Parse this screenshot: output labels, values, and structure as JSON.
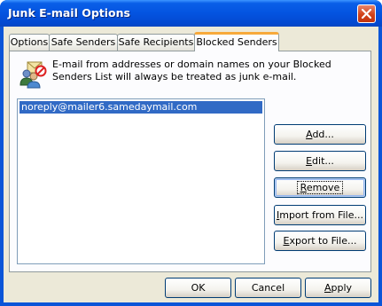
{
  "window": {
    "title": "Junk E-mail Options"
  },
  "tabs": [
    {
      "label": "Options"
    },
    {
      "label": "Safe Senders"
    },
    {
      "label": "Safe Recipients"
    },
    {
      "label": "Blocked Senders"
    }
  ],
  "active_tab": "Blocked Senders",
  "panel": {
    "description": "E-mail from addresses or domain names on your Blocked Senders List will always be treated as junk e-mail.",
    "list_items": [
      "noreply@mailer6.samedaymail.com"
    ],
    "buttons": {
      "add": {
        "label": "Add...",
        "accel": "A",
        "rest": "dd..."
      },
      "edit": {
        "label": "Edit...",
        "accel": "E",
        "rest": "dit..."
      },
      "remove": {
        "label": "Remove",
        "accel": "R",
        "rest": "emove"
      },
      "import": {
        "label": "Import from File...",
        "accel": "I",
        "rest": "mport from File..."
      },
      "export": {
        "label": "Export to File...",
        "accel": "E",
        "rest": "xport to File..."
      }
    }
  },
  "footer": {
    "ok": "OK",
    "cancel": "Cancel",
    "apply": {
      "label": "Apply",
      "accel": "A",
      "rest": "pply"
    }
  },
  "colors": {
    "titlebar": "#0454e0",
    "dialog_bg": "#ece9d8",
    "selection": "#316ac5",
    "active_tab_accent": "#f7a93b",
    "close_button": "#d1421a"
  },
  "icons": {
    "info": "blocked-senders-icon",
    "close": "close-icon"
  }
}
